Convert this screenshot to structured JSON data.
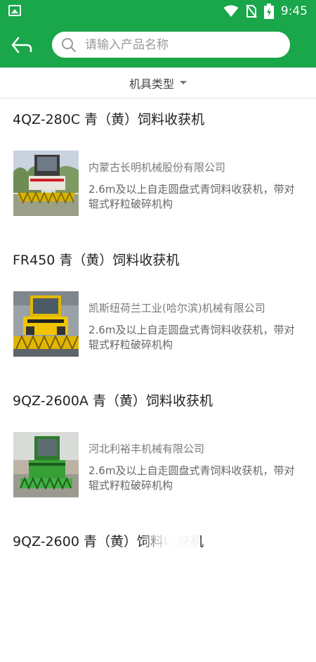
{
  "status_bar": {
    "time": "9:45",
    "icons": [
      "gallery-icon",
      "wifi-icon",
      "no-sim-icon",
      "battery-charging-icon"
    ]
  },
  "header": {
    "back_icon": "back-arrow-icon",
    "search": {
      "placeholder": "请输入产品名称",
      "value": "",
      "icon": "search-icon"
    }
  },
  "filter": {
    "label": "机具类型",
    "icon": "caret-down-icon"
  },
  "products": [
    {
      "title": "4QZ-280C 青（黄）饲料收获机",
      "company": "内蒙古长明机械股份有限公司",
      "description": "2.6m及以上自走圆盘式青饲料收获机，带对辊式籽粒破碎机构"
    },
    {
      "title": "FR450 青（黄）饲料收获机",
      "company": "凯斯纽荷兰工业(哈尔滨)机械有限公司",
      "description": "2.6m及以上自走圆盘式青饲料收获机，带对辊式籽粒破碎机构"
    },
    {
      "title": "9QZ-2600A 青（黄）饲料收获机",
      "company": "河北利裕丰机械有限公司",
      "description": "2.6m及以上自走圆盘式青饲料收获机，带对辊式籽粒破碎机构"
    },
    {
      "title": "9QZ-2600 青（黄）饲料收获机",
      "company": "",
      "description": ""
    }
  ],
  "colors": {
    "brand": "#1aa64a"
  }
}
